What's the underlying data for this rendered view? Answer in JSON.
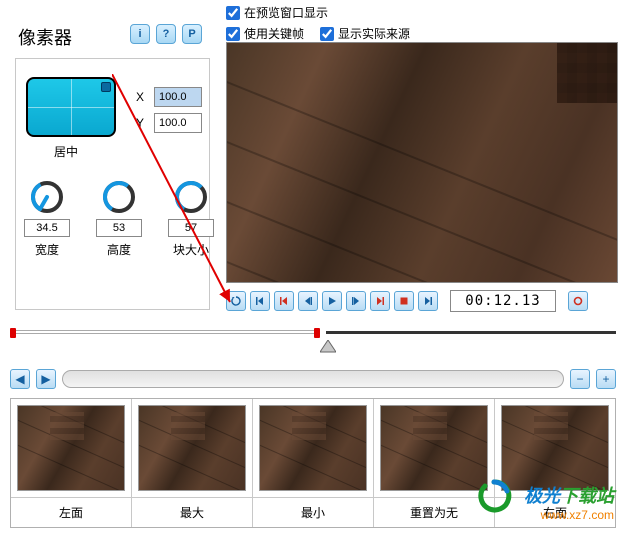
{
  "title": "像素器",
  "info_buttons": [
    "i",
    "?",
    "P"
  ],
  "checkboxes": {
    "show_in_preview": {
      "label": "在预览窗口显示",
      "checked": true
    },
    "use_keyframes": {
      "label": "使用关键帧",
      "checked": true
    },
    "show_actual_source": {
      "label": "显示实际来源",
      "checked": true
    }
  },
  "center_widget": {
    "label": "居中"
  },
  "xy": {
    "x_label": "X",
    "x_value": "100.0",
    "y_label": "Y",
    "y_value": "100.0"
  },
  "dials": [
    {
      "value": "34.5",
      "label": "宽度",
      "angle": 210
    },
    {
      "value": "53",
      "label": "高度",
      "angle": 300
    },
    {
      "value": "57",
      "label": "块大小",
      "angle": 300
    }
  ],
  "transport": {
    "buttons": [
      "loop",
      "first",
      "prev-key",
      "step-back",
      "play",
      "step-fwd",
      "next-key",
      "record",
      "last"
    ],
    "timecode": "00:12.13"
  },
  "nav_buttons": {
    "left": "◀",
    "right": "▶",
    "minus": "−",
    "plus": "+"
  },
  "thumbs": [
    {
      "label": "左面"
    },
    {
      "label": "最大"
    },
    {
      "label": "最小"
    },
    {
      "label": "重置为无"
    },
    {
      "label": "右面"
    }
  ],
  "watermark": {
    "line1_a": "极光",
    "line1_b": "下载站",
    "line2": "www.xz7.com"
  }
}
